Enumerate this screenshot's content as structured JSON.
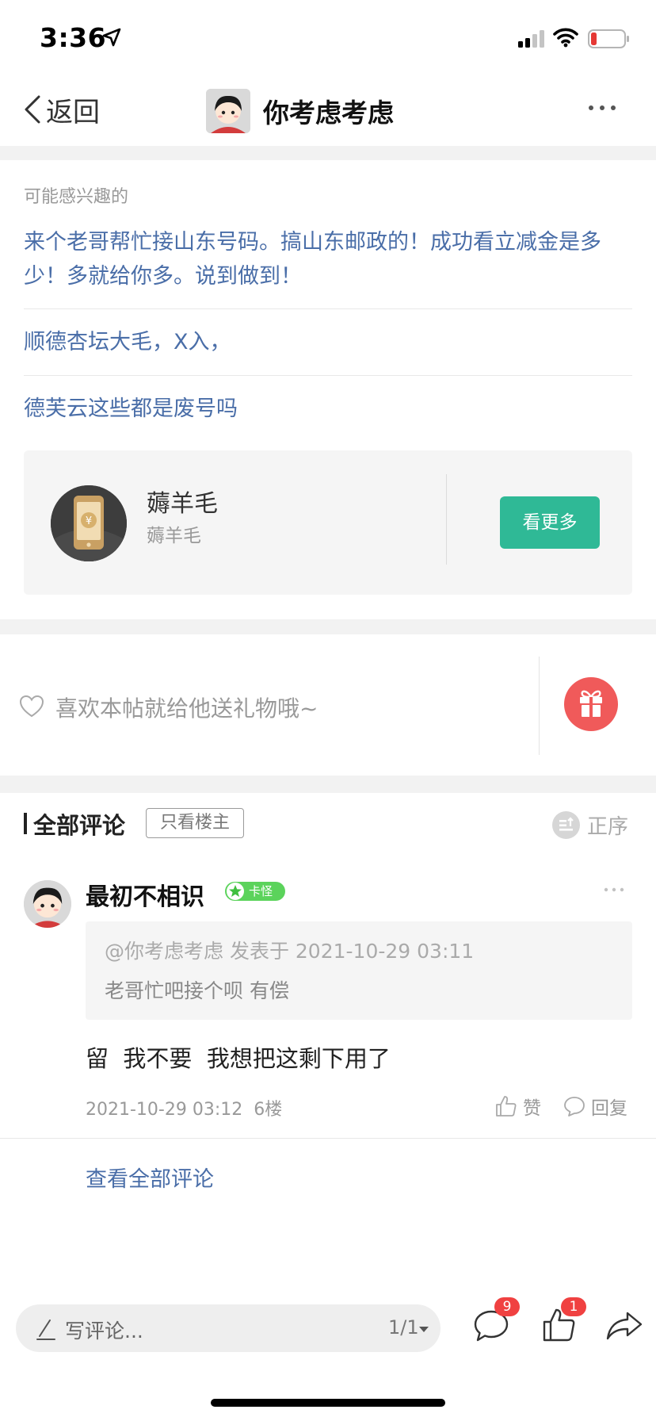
{
  "status_bar": {
    "time": "3:36"
  },
  "nav": {
    "back_label": "返回",
    "title": "你考虑考虑"
  },
  "recommended": {
    "heading": "可能感兴趣的",
    "items": [
      {
        "text": "来个老哥帮忙接山东号码。搞山东邮政的！成功看立减金是多少！多就给你多。说到做到！"
      },
      {
        "text": "顺德杏坛大毛，X入，"
      },
      {
        "text": "德芙云这些都是废号吗"
      }
    ]
  },
  "forum_card": {
    "name": "薅羊毛",
    "subtitle": "薅羊毛",
    "button_label": "看更多",
    "accent_color": "#2fb996"
  },
  "gift": {
    "prompt": "喜欢本帖就给他送礼物哦~",
    "button_color": "#f05a5a"
  },
  "comments_header": {
    "title": "全部评论",
    "op_only_label": "只看楼主",
    "order_label": "正序"
  },
  "comment": {
    "username": "最初不相识",
    "badge_text": "卡怪",
    "badge_color": "#5bd35b",
    "quote_meta": "@你考虑考虑 发表于 2021-10-29 03:11",
    "quote_text": "老哥忙吧接个呗 有偿",
    "body": "留  我不要  我想把这剩下用了",
    "meta": "2021-10-29 03:12  6楼",
    "like_label": "赞",
    "reply_label": "回复"
  },
  "view_all_label": "查看全部评论",
  "bottom_bar": {
    "placeholder": "写评论...",
    "page_indicator": "1/1",
    "comment_count": "9",
    "like_count": "1"
  }
}
